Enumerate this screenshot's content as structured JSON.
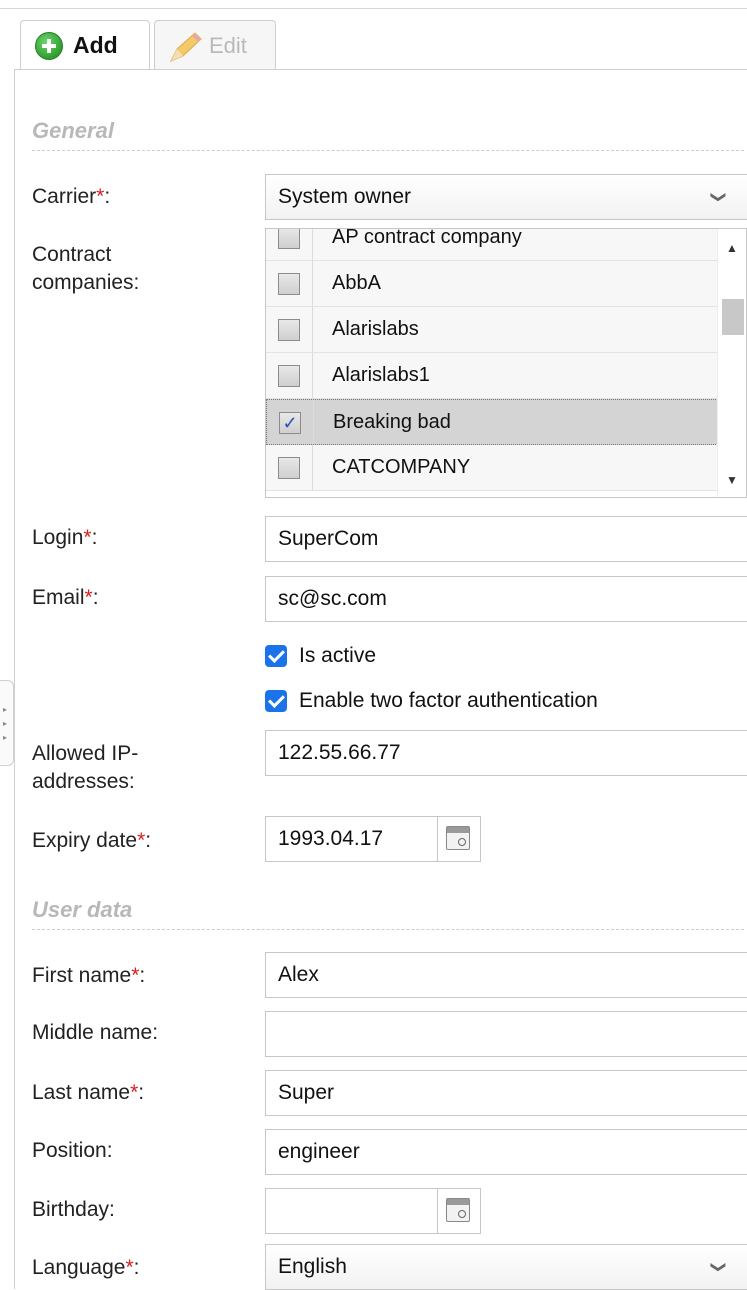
{
  "tabs": {
    "add_label": "Add",
    "edit_label": "Edit"
  },
  "sections": {
    "general": "General",
    "user_data": "User data"
  },
  "general": {
    "carrier_label": "Carrier",
    "carrier_value": "System owner",
    "contract_label_line1": "Contract",
    "contract_label_line2": "companies:",
    "contract_companies": [
      {
        "name": "AP contract company",
        "checked": false
      },
      {
        "name": "AbbA",
        "checked": false
      },
      {
        "name": "Alarislabs",
        "checked": false
      },
      {
        "name": "Alarislabs1",
        "checked": false
      },
      {
        "name": "Breaking bad",
        "checked": true
      },
      {
        "name": "CATCOMPANY",
        "checked": false
      }
    ],
    "login_label": "Login",
    "login_value": "SuperCom",
    "email_label": "Email",
    "email_value": "sc@sc.com",
    "is_active_label": "Is active",
    "two_factor_label": "Enable two factor authentication",
    "allowed_ip_label_line1": "Allowed IP-",
    "allowed_ip_label_line2": "addresses:",
    "allowed_ip_value": "122.55.66.77",
    "expiry_label": "Expiry date",
    "expiry_value": "1993.04.17"
  },
  "user_data": {
    "first_name_label": "First name",
    "first_name_value": "Alex",
    "middle_name_label": "Middle name:",
    "middle_name_value": "",
    "last_name_label": "Last name",
    "last_name_value": "Super",
    "position_label": "Position:",
    "position_value": "engineer",
    "birthday_label": "Birthday:",
    "birthday_value": "",
    "language_label": "Language",
    "language_value": "English"
  },
  "required_mark": "*",
  "colon": ":",
  "check_mark": "✓",
  "colors": {
    "required": "#d62020",
    "checkbox_blue": "#1a73e8",
    "section_text": "#b8b8b8"
  }
}
